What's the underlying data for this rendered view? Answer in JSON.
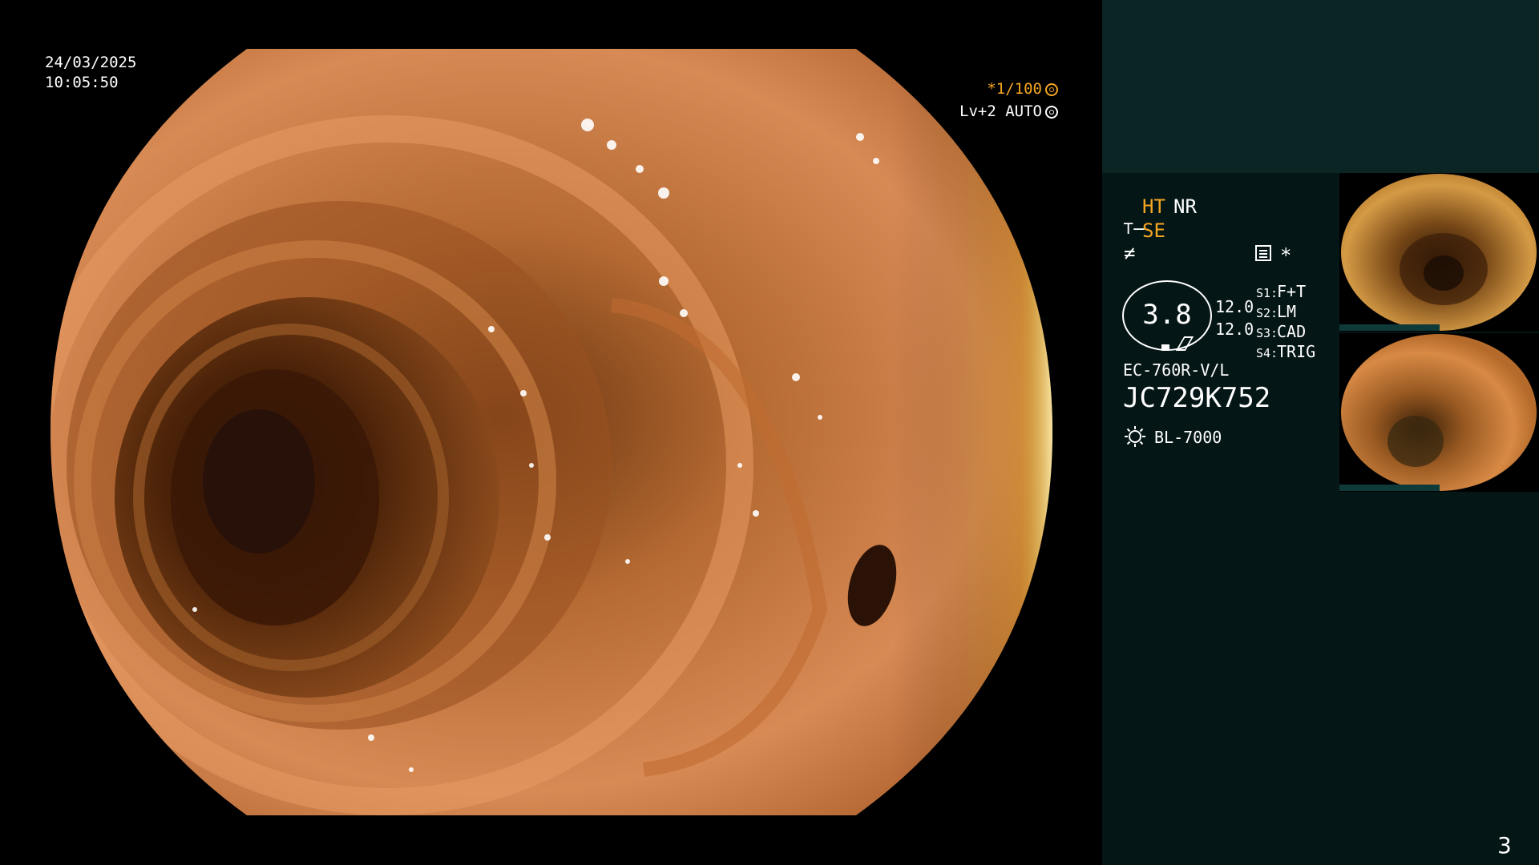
{
  "overlay": {
    "date": "24/03/2025",
    "time": "10:05:50",
    "shutter": "*1/100",
    "level": "Lv+2 AUTO"
  },
  "panel": {
    "ht": "HT",
    "nr": "NR",
    "se": "SE",
    "star": "*",
    "iris_value": "3.8",
    "value_a": "12.0",
    "value_b": "12.0",
    "slots": [
      {
        "key": "S1:",
        "value": "F+T"
      },
      {
        "key": "S2:",
        "value": "LM"
      },
      {
        "key": "S3:",
        "value": "CAD"
      },
      {
        "key": "S4:",
        "value": "TRIG"
      }
    ],
    "scope_model": "EC-760R-V/L",
    "scope_serial": "JC729K752",
    "light_source": "BL-7000",
    "page_number": "3"
  },
  "colors": {
    "accent_orange": "#f5a623",
    "panel_top": "#0b2424",
    "panel_bottom": "#051616"
  },
  "icons": {
    "shutter": "aperture-icon",
    "auto": "auto-exposure-icon",
    "structure_enhance": "structure-enhance-icon",
    "freeze": "freeze-icon",
    "menu": "menu-icon",
    "light": "light-source-icon"
  }
}
